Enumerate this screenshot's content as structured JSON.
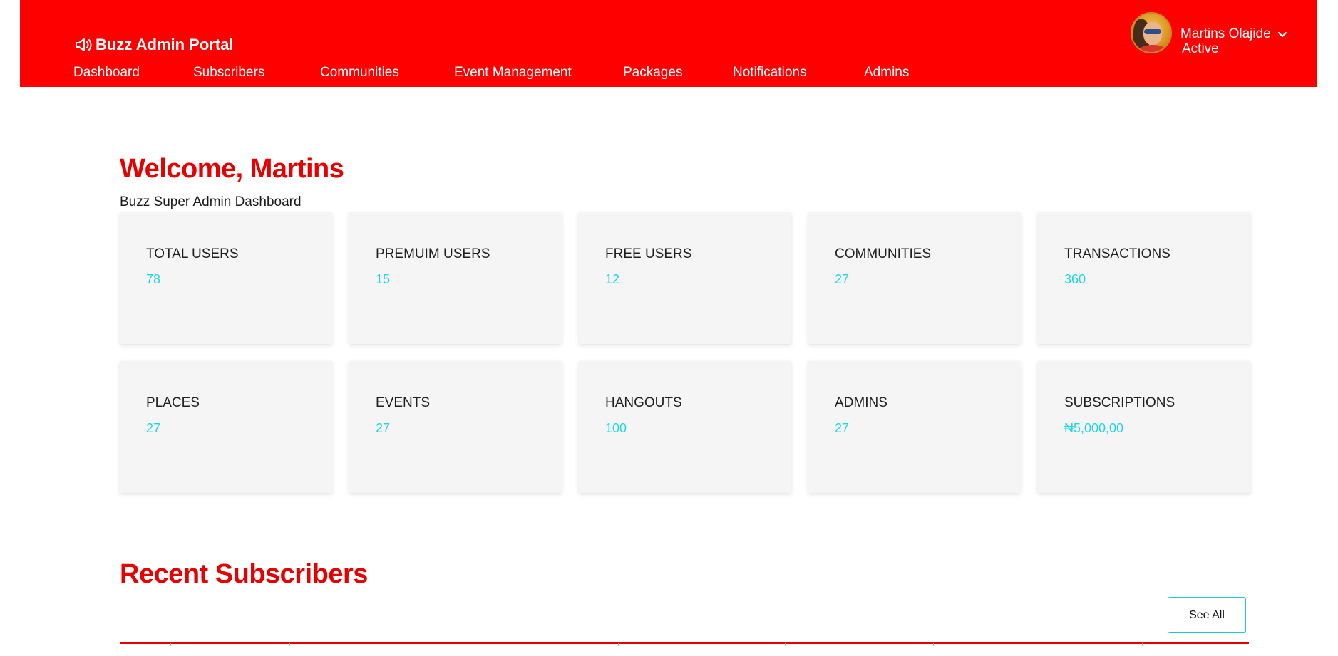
{
  "brand": {
    "name": "Buzz Admin Portal",
    "icon": "megaphone-icon"
  },
  "nav": [
    {
      "label": "Dashboard"
    },
    {
      "label": "Subscribers"
    },
    {
      "label": "Communities"
    },
    {
      "label": "Event Management"
    },
    {
      "label": "Packages"
    },
    {
      "label": "Notifications"
    },
    {
      "label": "Admins"
    }
  ],
  "user": {
    "name": "Martins Olajide",
    "status": "Active",
    "menu_icon": "chevron-down-icon"
  },
  "page": {
    "title": "Welcome, Martins",
    "subtitle": "Buzz Super Admin Dashboard"
  },
  "stats": [
    {
      "label": "TOTAL USERS",
      "value": "78"
    },
    {
      "label": "PREMUIM USERS",
      "value": "15"
    },
    {
      "label": "FREE USERS",
      "value": "12"
    },
    {
      "label": "COMMUNITIES",
      "value": "27"
    },
    {
      "label": "TRANSACTIONS",
      "value": "360"
    },
    {
      "label": "PLACES",
      "value": "27"
    },
    {
      "label": "EVENTS",
      "value": "27"
    },
    {
      "label": "HANGOUTS",
      "value": "100"
    },
    {
      "label": "ADMINS",
      "value": "27"
    },
    {
      "label": "SUBSCRIPTIONS",
      "value": "₦5,000,00"
    }
  ],
  "recent": {
    "title": "Recent Subscribers",
    "see_all_label": "See All"
  },
  "colors": {
    "header": "#ff0000",
    "heading": "#e60000",
    "value": "#1ed6e8",
    "card": "#f5f5f5"
  }
}
